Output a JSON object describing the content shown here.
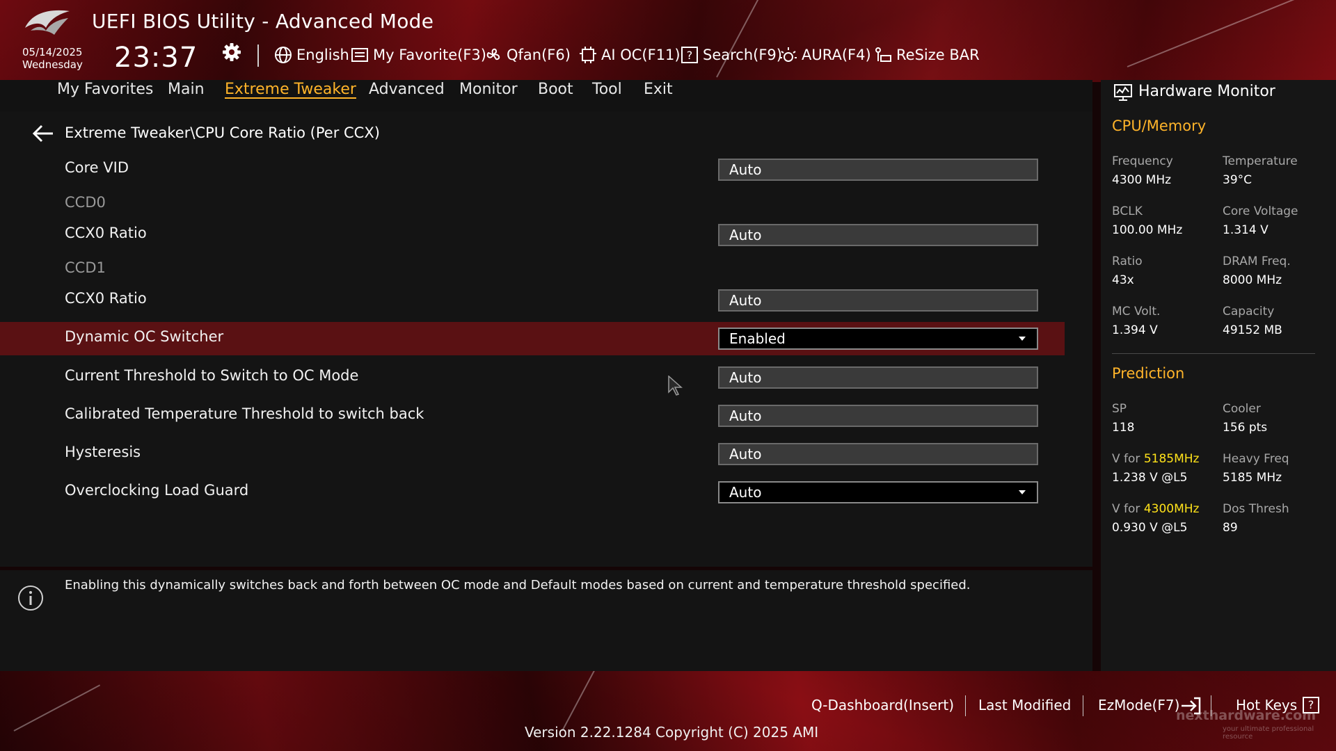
{
  "header": {
    "title": "UEFI BIOS Utility - Advanced Mode",
    "date": "05/14/2025",
    "weekday": "Wednesday",
    "time": "23:37",
    "toolbar": [
      {
        "label": "English",
        "icon": "globe-icon"
      },
      {
        "label": "My Favorite(F3)",
        "icon": "favorite-list-icon"
      },
      {
        "label": "Qfan(F6)",
        "icon": "fan-icon"
      },
      {
        "label": "AI OC(F11)",
        "icon": "ai-oc-icon"
      },
      {
        "label": "Search(F9)",
        "icon": "search-icon"
      },
      {
        "label": "AURA(F4)",
        "icon": "aura-icon"
      },
      {
        "label": "ReSize BAR",
        "icon": "resize-bar-icon"
      }
    ]
  },
  "nav": {
    "tabs": [
      "My Favorites",
      "Main",
      "Extreme Tweaker",
      "Advanced",
      "Monitor",
      "Boot",
      "Tool",
      "Exit"
    ],
    "active": "Extreme Tweaker"
  },
  "main": {
    "breadcrumb": "Extreme Tweaker\\CPU Core Ratio (Per CCX)",
    "rows": [
      {
        "label": "Core VID",
        "value": "Auto"
      },
      {
        "label": "CCD0"
      },
      {
        "label": "CCX0 Ratio",
        "value": "Auto"
      },
      {
        "label": "CCD1"
      },
      {
        "label": "CCX0 Ratio",
        "value": "Auto"
      },
      {
        "label": "Dynamic OC Switcher",
        "value": "Enabled"
      },
      {
        "label": "Current Threshold to Switch to OC Mode",
        "value": "Auto"
      },
      {
        "label": "Calibrated Temperature Threshold to switch back",
        "value": "Auto"
      },
      {
        "label": "Hysteresis",
        "value": "Auto"
      },
      {
        "label": "Overclocking Load Guard",
        "value": "Auto"
      }
    ]
  },
  "info": {
    "text": "Enabling this dynamically switches back and forth between OC mode and Default modes based on current and temperature threshold specified."
  },
  "hardware_monitor": {
    "title": "Hardware Monitor",
    "cpu_memory": {
      "title": "CPU/Memory",
      "items": [
        {
          "label": "Frequency",
          "value": "4300 MHz"
        },
        {
          "label": "Temperature",
          "value": "39°C"
        },
        {
          "label": "BCLK",
          "value": "100.00 MHz"
        },
        {
          "label": "Core Voltage",
          "value": "1.314 V"
        },
        {
          "label": "Ratio",
          "value": "43x"
        },
        {
          "label": "DRAM Freq.",
          "value": "8000 MHz"
        },
        {
          "label": "MC Volt.",
          "value": "1.394 V"
        },
        {
          "label": "Capacity",
          "value": "49152 MB"
        }
      ]
    },
    "prediction": {
      "title": "Prediction",
      "sp_label": "SP",
      "sp_value": "118",
      "cooler_label": "Cooler",
      "cooler_value": "156 pts",
      "vfor_prefix": "V for",
      "vfor1_freq": "5185MHz",
      "vfor1_value": "1.238 V @L5",
      "heavy_label": "Heavy Freq",
      "heavy_value": "5185 MHz",
      "vfor2_freq": "4300MHz",
      "vfor2_value": "0.930 V @L5",
      "dos_label": "Dos Thresh",
      "dos_value": "89"
    }
  },
  "footer": {
    "qdashboard": "Q-Dashboard(Insert)",
    "last_modified": "Last Modified",
    "ezmode": "EzMode(F7)",
    "hotkeys": "Hot Keys",
    "hotkeys_icon": "?",
    "version": "Version 2.22.1284 Copyright (C) 2025 AMI",
    "watermark": "nexthardware.com",
    "watermark_sub": "your ultimate professional resource"
  },
  "colors": {
    "accent": "#ffb42a",
    "highlight_row": "#5a1113",
    "yellow": "#ffe21a"
  }
}
